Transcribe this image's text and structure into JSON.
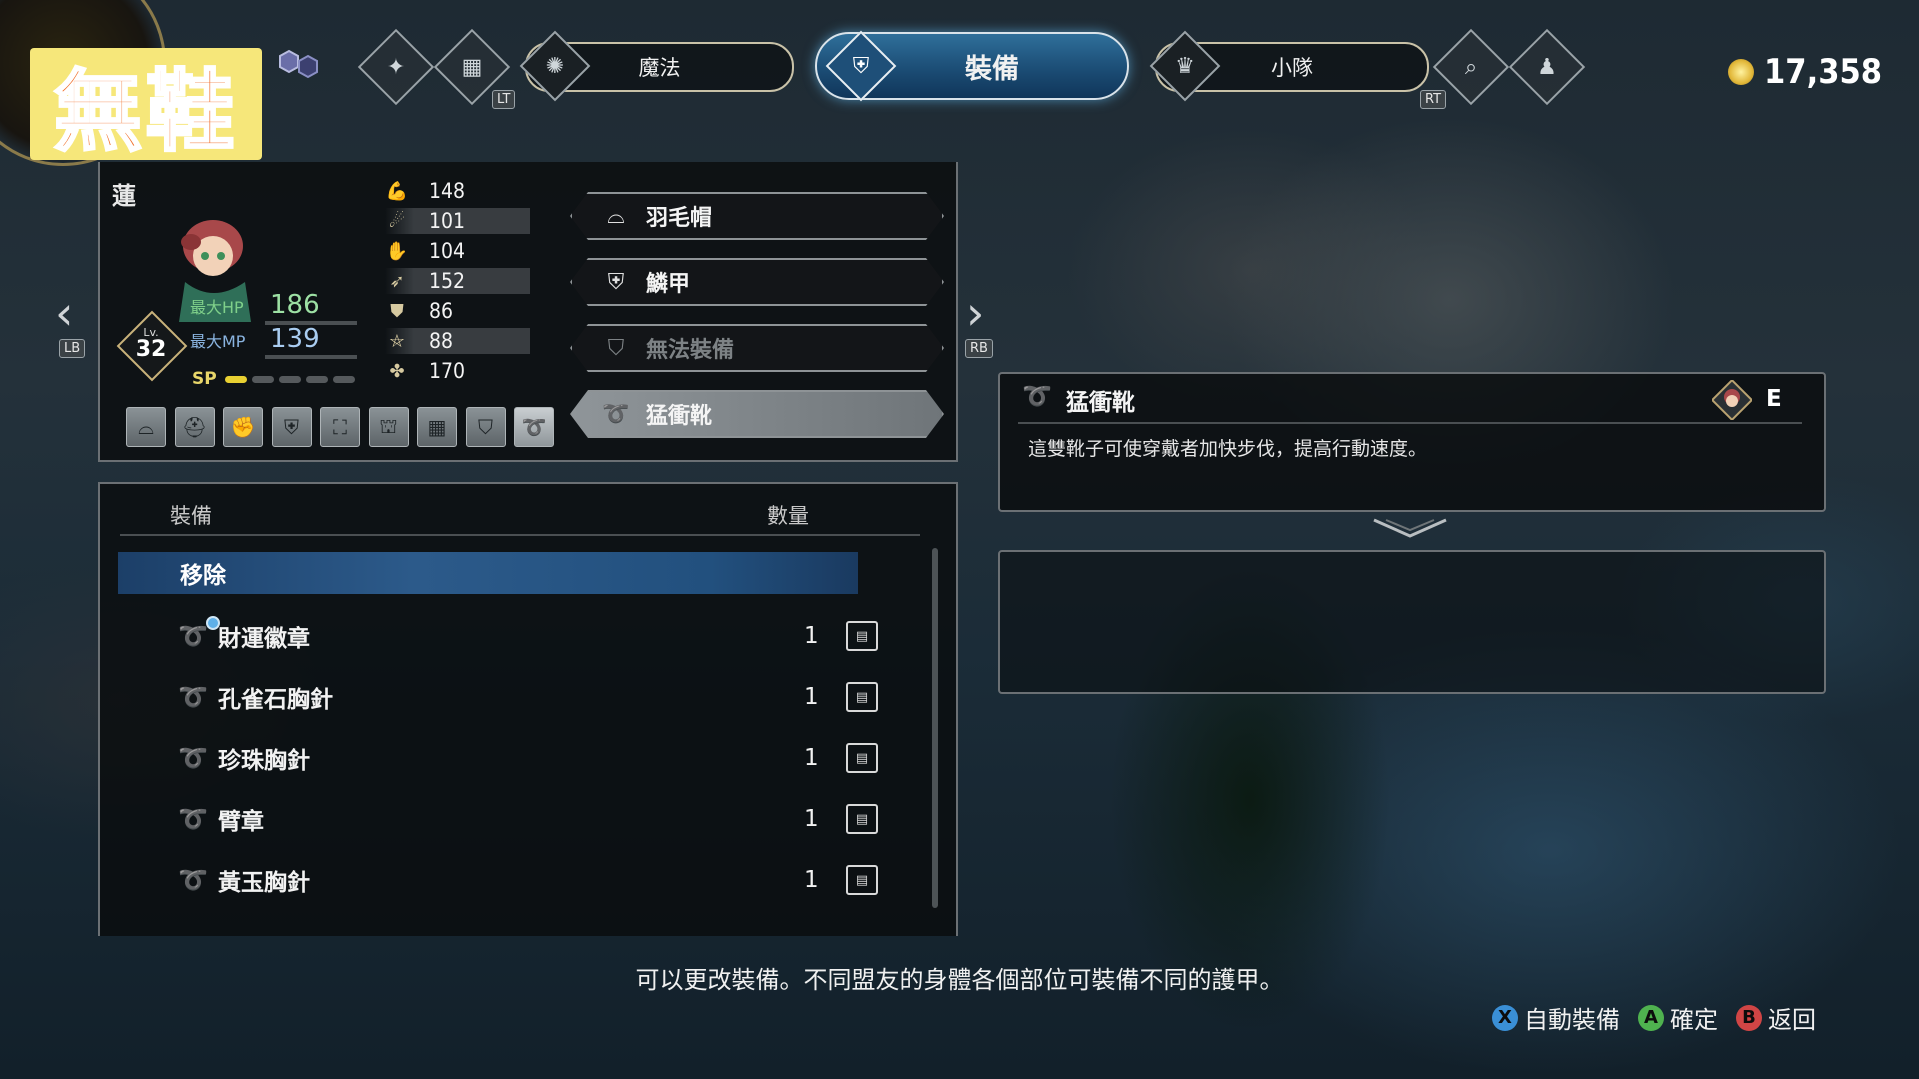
{
  "overlay_badge": "無鞋",
  "gold": {
    "amount": "17,358"
  },
  "topbar": {
    "trigger_left": "LT",
    "trigger_right": "RT",
    "tabs": [
      {
        "label": "魔法",
        "icon": "magic-swirl-icon"
      },
      {
        "label": "裝備",
        "icon": "armor-icon",
        "active": true
      },
      {
        "label": "小隊",
        "icon": "party-icon"
      }
    ]
  },
  "character": {
    "name": "蓮",
    "level_label": "Lv.",
    "level": "32",
    "hp_label": "最大HP",
    "hp": "186",
    "mp_label": "最大MP",
    "mp": "139",
    "sp_label": "SP",
    "sp_filled": 1,
    "sp_total": 5,
    "shoulder_left": "LB",
    "shoulder_right": "RB"
  },
  "stats": [
    {
      "icon": "strength-icon",
      "value": "148"
    },
    {
      "icon": "magic-icon",
      "value": "101"
    },
    {
      "icon": "dexterity-icon",
      "value": "104"
    },
    {
      "icon": "agility-icon",
      "value": "152"
    },
    {
      "icon": "defense-icon",
      "value": "86"
    },
    {
      "icon": "resistance-icon",
      "value": "88"
    },
    {
      "icon": "luck-icon",
      "value": "170"
    }
  ],
  "equipment_slots": [
    {
      "label": "羽毛帽",
      "icon": "hat-icon"
    },
    {
      "label": "鱗甲",
      "icon": "body-armor-icon"
    },
    {
      "label": "無法裝備",
      "icon": "shield-icon",
      "disabled": true
    },
    {
      "label": "猛衝靴",
      "icon": "accessory-icon",
      "selected": true
    }
  ],
  "slot_icons": [
    "hat-icon",
    "helmet-icon",
    "gauntlet-icon",
    "armor-icon",
    "robe-icon",
    "heavy-armor-icon",
    "mail-icon",
    "shield-icon",
    "accessory-icon"
  ],
  "list": {
    "header_name": "裝備",
    "header_qty": "數量",
    "remove_label": "移除",
    "items": [
      {
        "name": "財運徽章",
        "qty": "1",
        "new": true
      },
      {
        "name": "孔雀石胸針",
        "qty": "1"
      },
      {
        "name": "珍珠胸針",
        "qty": "1"
      },
      {
        "name": "臂章",
        "qty": "1"
      },
      {
        "name": "黃玉胸針",
        "qty": "1"
      }
    ]
  },
  "detail": {
    "title": "猛衝靴",
    "equipped_marker": "E",
    "description": "這雙靴子可使穿戴者加快步伐，提高行動速度。"
  },
  "hint": "可以更改裝備。不同盟友的身體各個部位可裝備不同的護甲。",
  "controls": [
    {
      "button": "X",
      "label": "自動裝備",
      "color": "#3a8fd6"
    },
    {
      "button": "A",
      "label": "確定",
      "color": "#4fb24f"
    },
    {
      "button": "B",
      "label": "返回",
      "color": "#d04545"
    }
  ]
}
